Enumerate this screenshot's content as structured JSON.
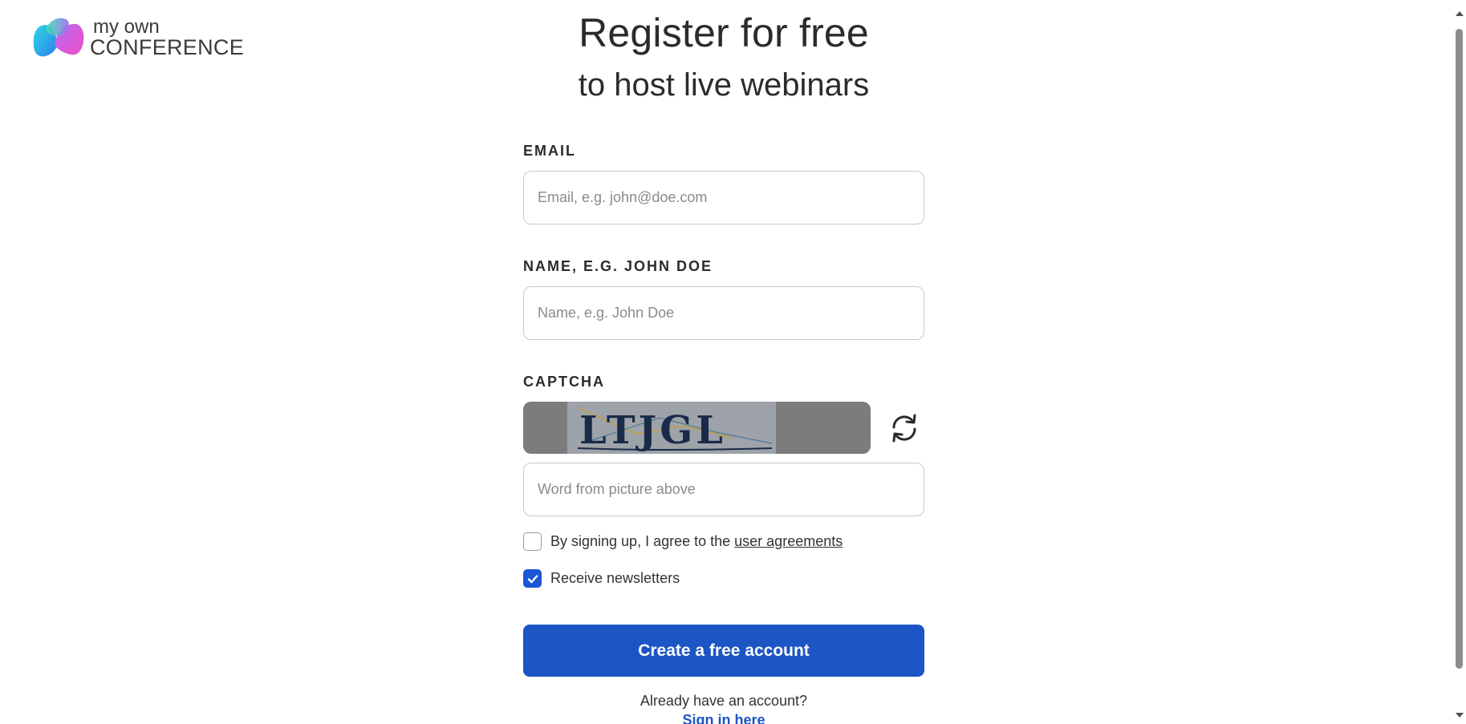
{
  "logo": {
    "line1": "my own",
    "line2": "CONFERENCE",
    "icon": "myownconference-logo-icon"
  },
  "header": {
    "title": "Register for free",
    "subtitle": "to host live webinars"
  },
  "form": {
    "email": {
      "label": "EMAIL",
      "placeholder": "Email, e.g. john@doe.com",
      "value": ""
    },
    "name": {
      "label": "NAME, E.G. JOHN DOE",
      "placeholder": "Name, e.g. John Doe",
      "value": ""
    },
    "captcha": {
      "label": "CAPTCHA",
      "image_text": "LTJGL",
      "refresh_icon": "refresh-icon",
      "placeholder": "Word from picture above",
      "value": ""
    },
    "agreement": {
      "checked": false,
      "text": "By signing up, I agree to the",
      "link_text": "user agreements"
    },
    "newsletter": {
      "checked": true,
      "text": "Receive newsletters"
    },
    "submit_label": "Create a free account",
    "already_text": "Already have an account?",
    "signin_text": "Sign in here"
  },
  "colors": {
    "primary": "#1c55c4",
    "checkbox_checked": "#1a56d6",
    "captcha_bg": "#7c7c7c"
  }
}
